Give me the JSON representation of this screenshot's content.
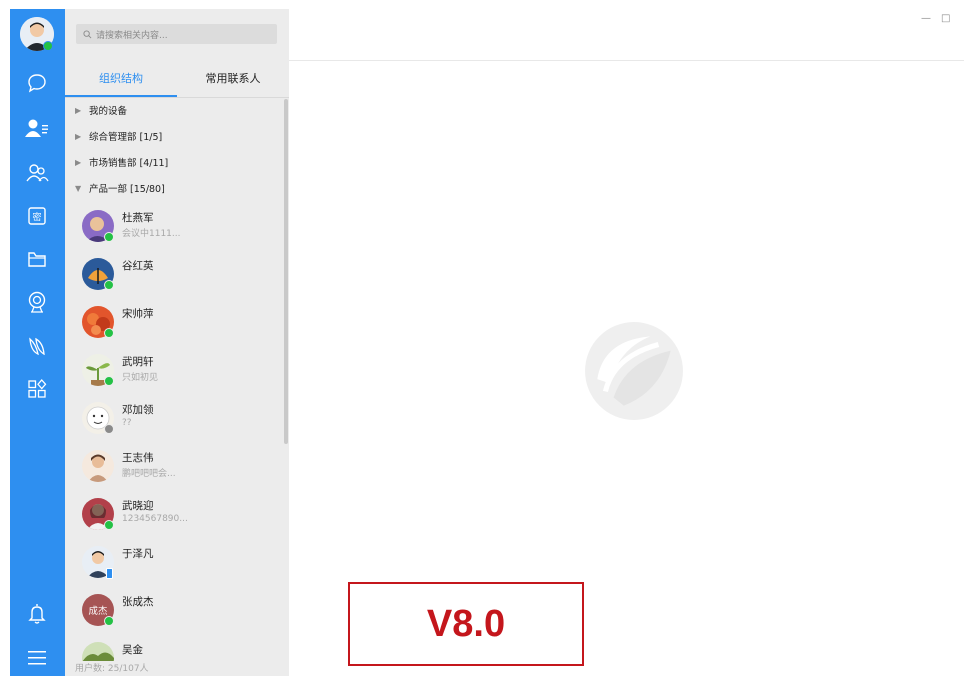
{
  "search": {
    "placeholder": "请搜索相关内容..."
  },
  "tabs": [
    {
      "label": "组织结构",
      "active": true
    },
    {
      "label": "常用联系人",
      "active": false
    }
  ],
  "groups": [
    {
      "label": "我的设备",
      "expanded": false
    },
    {
      "label": "综合管理部 [1/5]",
      "expanded": false
    },
    {
      "label": "市场销售部 [4/11]",
      "expanded": false
    },
    {
      "label": "产品一部 [15/80]",
      "expanded": true
    }
  ],
  "contacts": [
    {
      "name": "杜燕军",
      "status": "会议中1111...",
      "online": true,
      "avatar_color": "#8a6bc5"
    },
    {
      "name": "谷红英",
      "status": "",
      "online": true,
      "avatar_color": "#2b5a9a"
    },
    {
      "name": "宋帅萍",
      "status": "",
      "online": true,
      "avatar_color": "#e2552c"
    },
    {
      "name": "武明轩",
      "status": "只如初见",
      "online": true,
      "avatar_color": "#6b9a3a"
    },
    {
      "name": "邓加领",
      "status": "??",
      "online": false,
      "avatar_color": "#f3f0e8"
    },
    {
      "name": "王志伟",
      "status": "鹏吧吧吧会...",
      "online": false,
      "avatar_color": "#c79a7c"
    },
    {
      "name": "武晓迎",
      "status": "1234567890...",
      "online": true,
      "avatar_color": "#b2404a"
    },
    {
      "name": "于泽凡",
      "status": "",
      "online": false,
      "avatar_color": "#30415a"
    },
    {
      "name": "张成杰",
      "status": "",
      "online": true,
      "avatar_color": "#a65454",
      "initials": "成杰"
    },
    {
      "name": "吴金",
      "status": "",
      "online": false,
      "avatar_color": "#6b8c3a"
    }
  ],
  "footer": {
    "user_count": "用户数: 25/107人"
  },
  "window_controls": {
    "minimize": "—",
    "maximize": "□"
  },
  "version": {
    "label": "V8.0"
  },
  "colors": {
    "accent": "#2e8ff0",
    "online": "#24c145",
    "version_red": "#c4161c"
  },
  "rail_icons": [
    "chat-icon",
    "contacts-icon",
    "group-icon",
    "secret-icon",
    "folder-icon",
    "camera-icon",
    "leaf-icon",
    "apps-icon",
    "bell-icon",
    "menu-icon"
  ]
}
